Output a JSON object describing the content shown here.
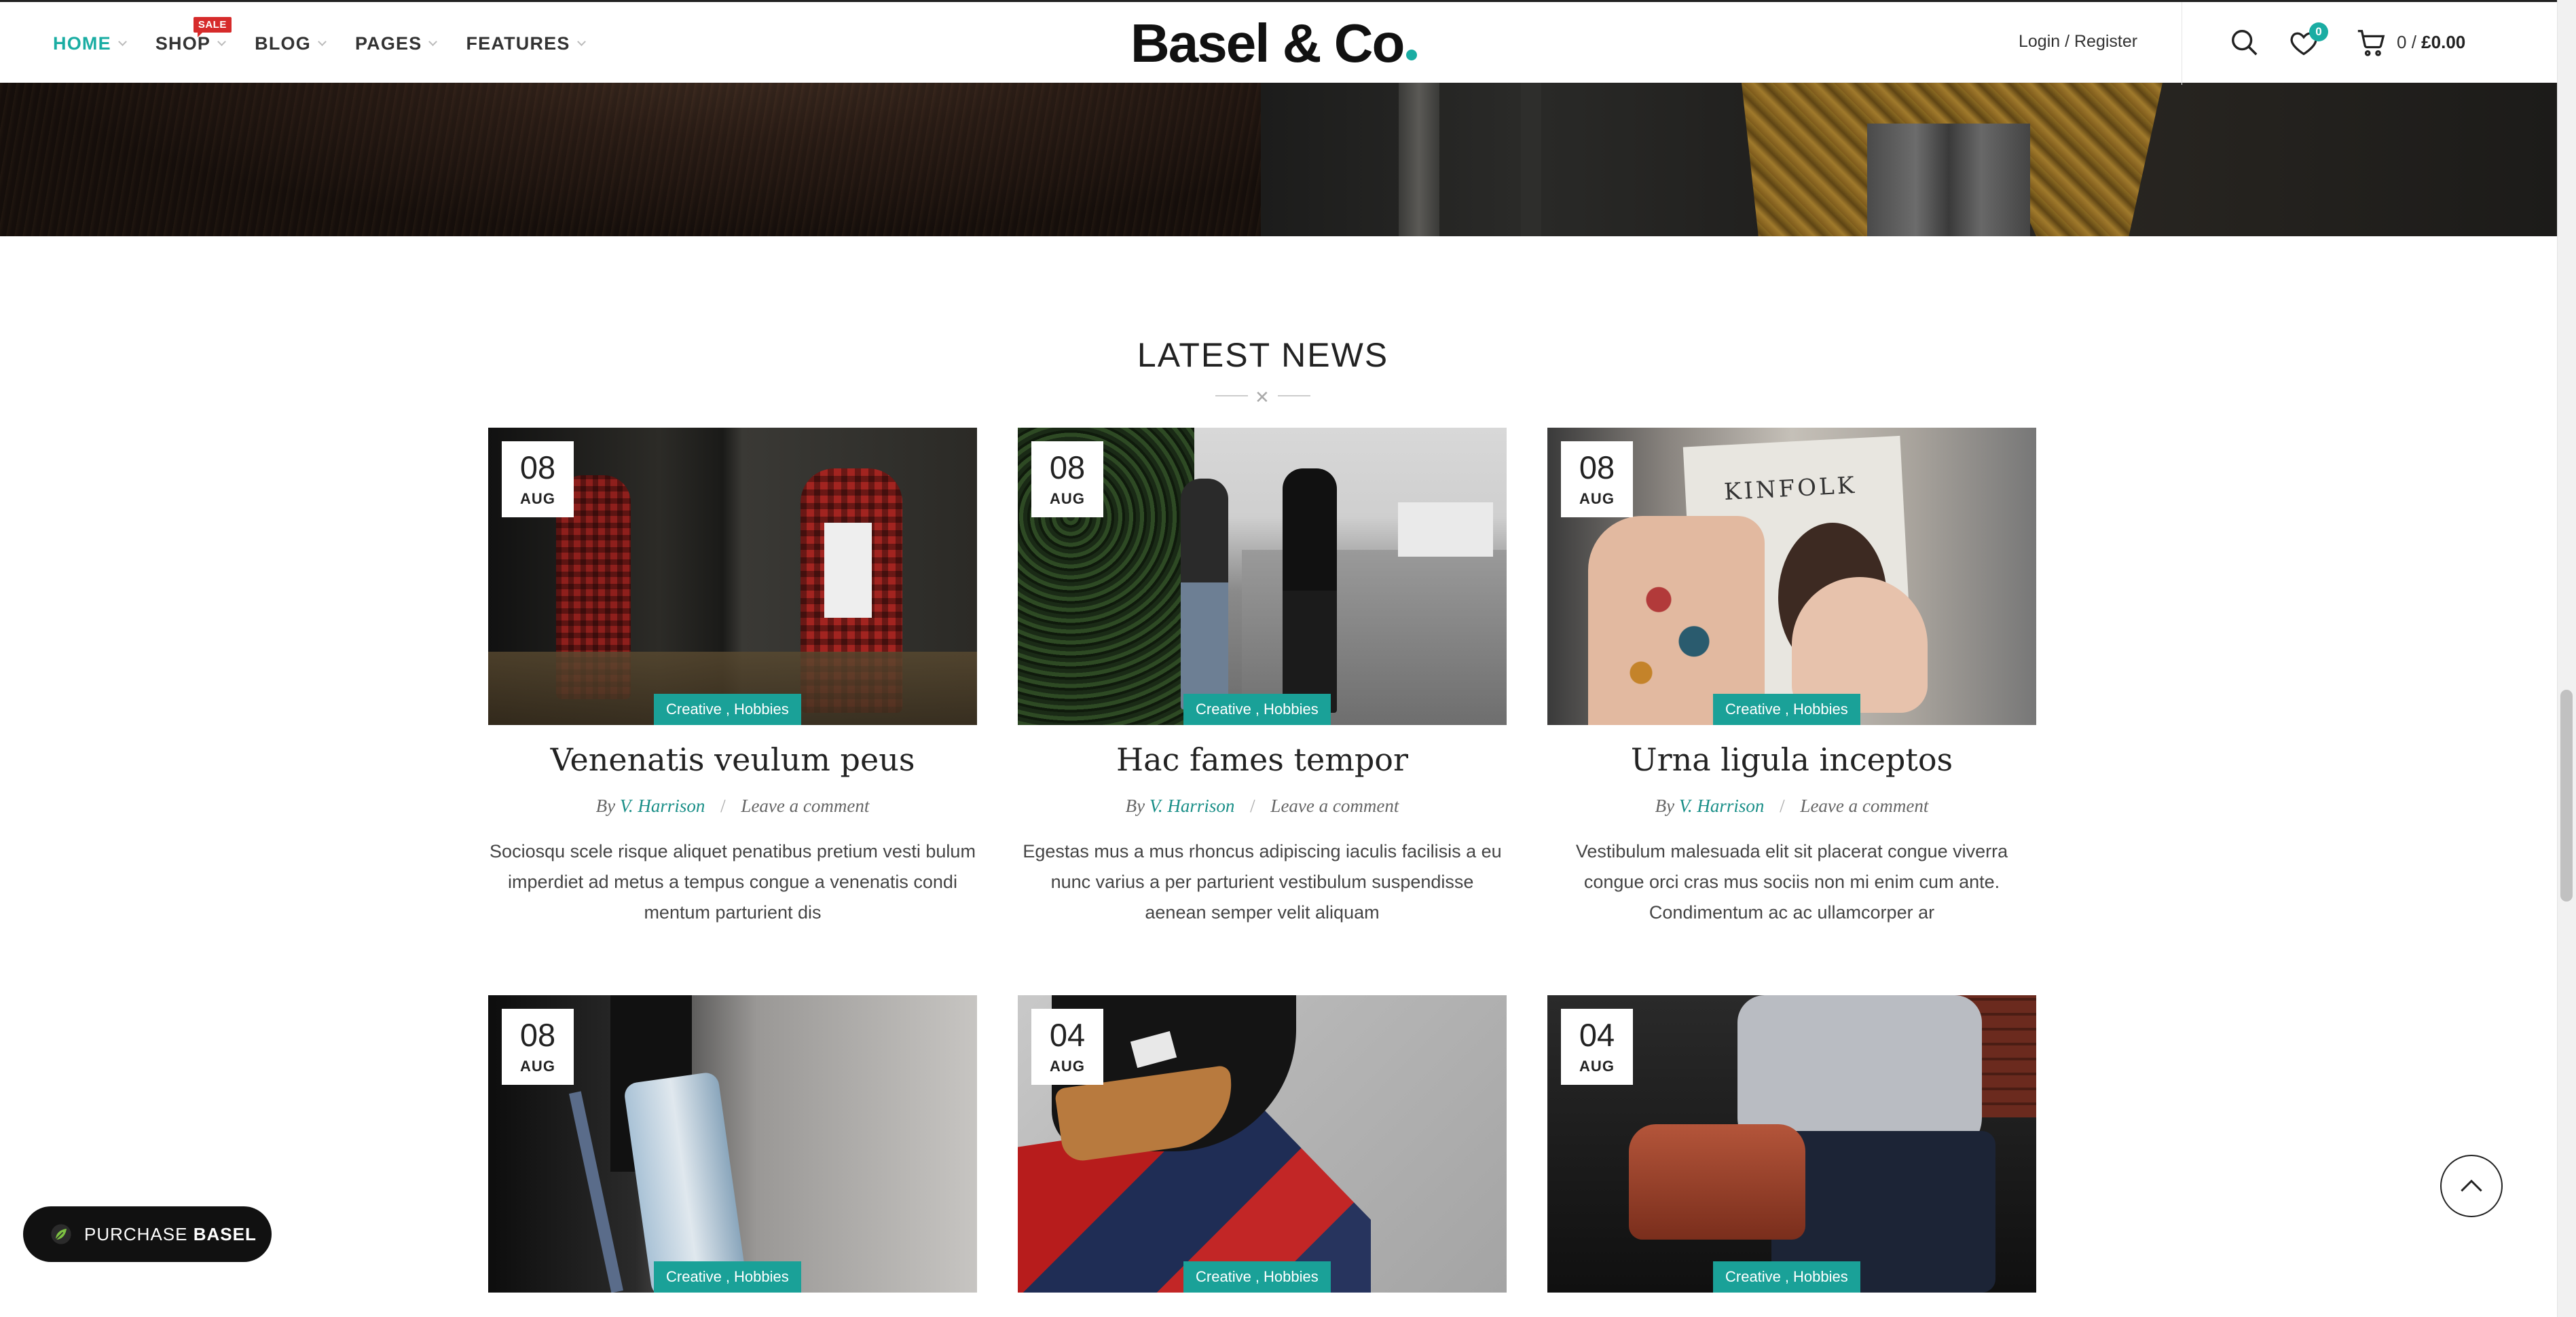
{
  "nav": {
    "items": [
      {
        "label": "HOME"
      },
      {
        "label": "SHOP",
        "badge": "SALE"
      },
      {
        "label": "BLOG"
      },
      {
        "label": "PAGES"
      },
      {
        "label": "FEATURES"
      }
    ]
  },
  "brand": {
    "logo": "Basel & Co",
    "accent_color": "#1aada3"
  },
  "header": {
    "login": "Login / Register",
    "wishlist_count": "0",
    "cart_count": "0",
    "cart_sep": "/",
    "cart_total": "£0.00",
    "icons": [
      "search-icon",
      "heart-icon",
      "cart-icon"
    ]
  },
  "section": {
    "title": "LATEST NEWS",
    "separator": "✕"
  },
  "posts": [
    {
      "day": "08",
      "month": "AUG",
      "cats": [
        "Creative",
        "Hobbies"
      ],
      "title": "Venenatis veulum peus",
      "by": "By",
      "author": "V. Harrison",
      "sep": "/",
      "comment": "Leave a comment",
      "excerpt": "Sociosqu scele risque aliquet penatibus pretium vesti bulum imperdiet ad metus a tempus congue a venenatis condi mentum parturient dis"
    },
    {
      "day": "08",
      "month": "AUG",
      "cats": [
        "Creative",
        "Hobbies"
      ],
      "title": "Hac fames tempor",
      "by": "By",
      "author": "V. Harrison",
      "sep": "/",
      "comment": "Leave a comment",
      "excerpt": "Egestas mus a mus rhoncus adipiscing iaculis facilisis a eu nunc varius a per parturient vestibulum suspendisse aenean semper velit aliquam"
    },
    {
      "day": "08",
      "month": "AUG",
      "cats": [
        "Creative",
        "Hobbies"
      ],
      "title": "Urna ligula inceptos",
      "by": "By",
      "author": "V. Harrison",
      "sep": "/",
      "comment": "Leave a comment",
      "excerpt": "Vestibulum malesuada elit sit placerat congue viverra congue orci cras mus sociis non mi enim cum ante. Condimentum ac ac ullamcorper ar",
      "image_text": "KINFOLK"
    },
    {
      "day": "08",
      "month": "AUG",
      "cats": [
        "Creative",
        "Hobbies"
      ]
    },
    {
      "day": "04",
      "month": "AUG",
      "cats": [
        "Creative",
        "Hobbies"
      ]
    },
    {
      "day": "04",
      "month": "AUG",
      "cats": [
        "Creative",
        "Hobbies"
      ]
    }
  ],
  "floating": {
    "purchase_prefix": "PURCHASE",
    "purchase_brand": "BASEL"
  }
}
